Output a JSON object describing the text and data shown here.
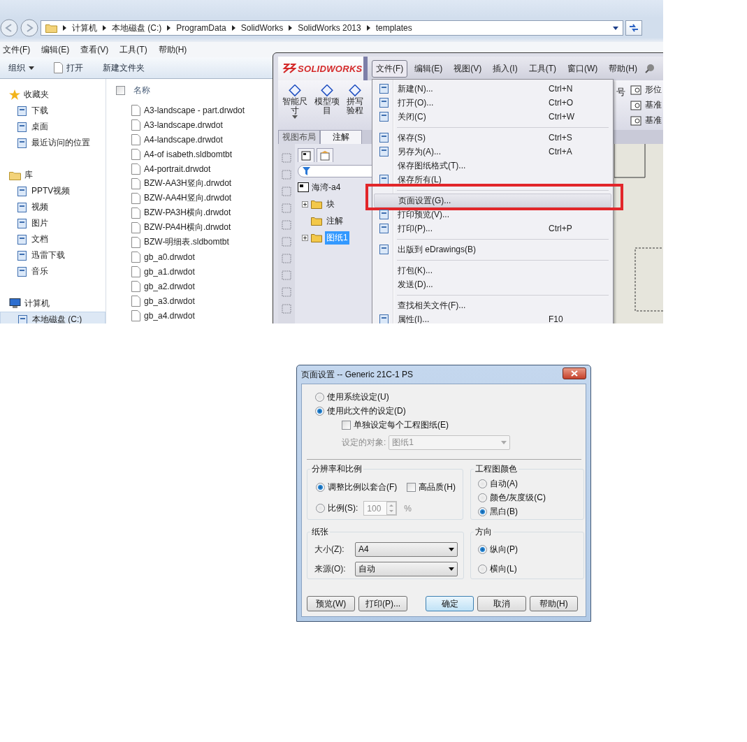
{
  "explorer": {
    "breadcrumb": [
      "计算机",
      "本地磁盘 (C:)",
      "ProgramData",
      "SolidWorks",
      "SolidWorks 2013",
      "templates"
    ],
    "menu": [
      "文件(F)",
      "编辑(E)",
      "查看(V)",
      "工具(T)",
      "帮助(H)"
    ],
    "toolbar": [
      {
        "label": "组织",
        "kind": "dropdown"
      },
      {
        "label": "打开",
        "kind": "file"
      },
      {
        "label": "新建文件夹",
        "kind": "plain"
      }
    ],
    "nav": [
      {
        "label": "收藏夹",
        "selected": false,
        "children": [
          {
            "label": "下载",
            "selected": false
          },
          {
            "label": "桌面",
            "selected": false
          },
          {
            "label": "最近访问的位置",
            "selected": false
          }
        ]
      },
      {
        "label": "库",
        "selected": false,
        "children": [
          {
            "label": "PPTV视频",
            "selected": false
          },
          {
            "label": "视频",
            "selected": false
          },
          {
            "label": "图片",
            "selected": false
          },
          {
            "label": "文档",
            "selected": false
          },
          {
            "label": "迅雷下载",
            "selected": false
          },
          {
            "label": "音乐",
            "selected": false
          }
        ]
      },
      {
        "label": "计算机",
        "selected": false,
        "children": [
          {
            "label": "本地磁盘 (C:)",
            "selected": true
          }
        ]
      }
    ],
    "select_all_checked": false,
    "column_header": "名称",
    "files": [
      "A3-landscape - part.drwdot",
      "A3-landscape.drwdot",
      "A4-landscape.drwdot",
      "A4-of isabeth.sldbomtbt",
      "A4-portrait.drwdot",
      "BZW-AA3H竖向.drwdot",
      "BZW-AA4H竖向.drwdot",
      "BZW-PA3H横向.drwdot",
      "BZW-PA4H横向.drwdot",
      "BZW-明细表.sldbomtbt",
      "gb_a0.drwdot",
      "gb_a1.drwdot",
      "gb_a2.drwdot",
      "gb_a3.drwdot",
      "gb_a4.drwdot"
    ]
  },
  "solidworks": {
    "logo": "SOLIDWORKS",
    "menu": [
      {
        "label": "文件(F)",
        "selected": true
      },
      {
        "label": "编辑(E)",
        "selected": false
      },
      {
        "label": "视图(V)",
        "selected": false
      },
      {
        "label": "插入(I)",
        "selected": false
      },
      {
        "label": "工具(T)",
        "selected": false
      },
      {
        "label": "窗口(W)",
        "selected": false
      },
      {
        "label": "帮助(H)",
        "selected": false
      }
    ],
    "ribbon": [
      {
        "lines": [
          "智能尺",
          "寸"
        ]
      },
      {
        "lines": [
          "模型项",
          "目"
        ]
      },
      {
        "lines": [
          "拼写",
          "验程"
        ]
      }
    ],
    "ribbon_fragment": "号",
    "ribbon_right": [
      "形位",
      "基准",
      "基准"
    ],
    "tabs": [
      {
        "label": "视图布局",
        "selected": false
      },
      {
        "label": "注解",
        "selected": true
      }
    ],
    "tree": {
      "label": "海湾-a4",
      "children": [
        {
          "label": "块",
          "expandable": true,
          "selected": false
        },
        {
          "label": "注解",
          "expandable": false,
          "selected": false
        },
        {
          "label": "图纸1",
          "expandable": true,
          "selected": true
        }
      ]
    }
  },
  "file_menu": [
    [
      {
        "label": "新建(N)...",
        "shortcut": "Ctrl+N",
        "icon": true,
        "selected": false
      },
      {
        "label": "打开(O)...",
        "shortcut": "Ctrl+O",
        "icon": true,
        "selected": false
      },
      {
        "label": "关闭(C)",
        "shortcut": "Ctrl+W",
        "icon": true,
        "selected": false
      }
    ],
    [
      {
        "label": "保存(S)",
        "shortcut": "Ctrl+S",
        "icon": true,
        "selected": false
      },
      {
        "label": "另存为(A)...",
        "shortcut": "Ctrl+A",
        "icon": true,
        "selected": false
      },
      {
        "label": "保存图纸格式(T)...",
        "icon": false,
        "selected": false
      },
      {
        "label": "保存所有(L)",
        "icon": true,
        "selected": false
      }
    ],
    [
      {
        "label": "页面设置(G)...",
        "icon": false,
        "selected": true
      },
      {
        "label": "打印预览(V)...",
        "icon": true,
        "selected": false
      },
      {
        "label": "打印(P)...",
        "shortcut": "Ctrl+P",
        "icon": true,
        "selected": false
      }
    ],
    [
      {
        "label": "出版到 eDrawings(B)",
        "icon": true,
        "selected": false
      }
    ],
    [
      {
        "label": "打包(K)...",
        "icon": false,
        "selected": false
      },
      {
        "label": "发送(D)...",
        "icon": false,
        "selected": false
      }
    ],
    [
      {
        "label": "查找相关文件(F)...",
        "icon": false,
        "selected": false
      },
      {
        "label": "属性(I)...",
        "shortcut": "F10",
        "icon": true,
        "selected": false
      }
    ]
  ],
  "dialog": {
    "title": "页面设置 -- Generic 21C-1 PS",
    "source": [
      {
        "label": "使用系统设定(U)",
        "selected": false
      },
      {
        "label": "使用此文件的设定(D)",
        "selected": true
      }
    ],
    "per_sheet": {
      "label": "单独设定每个工程图纸(E)",
      "checked": false
    },
    "target": {
      "label": "设定的对象:",
      "value": "图纸1",
      "disabled": true
    },
    "resolution": {
      "title": "分辨率和比例",
      "fit": {
        "label": "调整比例以套合(F)",
        "selected": true
      },
      "high_quality": {
        "label": "高品质(H)",
        "checked": false
      },
      "scale": {
        "label": "比例(S):",
        "selected": false,
        "value": "100",
        "unit": "%",
        "disabled": true
      }
    },
    "color": {
      "title": "工程图颜色",
      "options": [
        {
          "label": "自动(A)",
          "selected": false
        },
        {
          "label": "颜色/灰度级(C)",
          "selected": false
        },
        {
          "label": "黑白(B)",
          "selected": true
        }
      ]
    },
    "paper": {
      "title": "纸张",
      "fields": [
        {
          "label": "大小(Z):",
          "value": "A4"
        },
        {
          "label": "来源(O):",
          "value": "自动"
        }
      ]
    },
    "orientation": {
      "title": "方向",
      "options": [
        {
          "label": "纵向(P)",
          "selected": true
        },
        {
          "label": "横向(L)",
          "selected": false
        }
      ]
    },
    "buttons": [
      {
        "label": "预览(W)",
        "default": false
      },
      {
        "label": "打印(P)...",
        "default": false
      },
      {
        "label": "确定",
        "default": true
      },
      {
        "label": "取消",
        "default": false
      },
      {
        "label": "帮助(H)",
        "default": false
      }
    ]
  }
}
